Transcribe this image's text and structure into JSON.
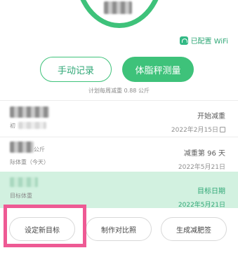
{
  "wifi": {
    "label": "已配置 WiFi",
    "icon": "wifi-icon"
  },
  "buttons": {
    "manual": "手动记录",
    "scale": "体脂秤测量"
  },
  "plan": "计划每周减重 0.88 公斤",
  "start": {
    "label": "开始减重",
    "date": "2022年2月15日",
    "left_small": "初"
  },
  "progress": {
    "label": "减重第 96 天",
    "date": "2022年5月21日",
    "unit": "公斤",
    "current": "际体重（今天）"
  },
  "target": {
    "label": "目标日期",
    "date": "2022年5月21日",
    "left": "目标体重"
  },
  "actions": {
    "set_goal": "设定新目标",
    "compare": "制作对比照",
    "tag": "生成减肥签"
  },
  "colors": {
    "accent": "#3ec27a",
    "band": "#d2f1e0",
    "highlight": "#ee5a94"
  }
}
